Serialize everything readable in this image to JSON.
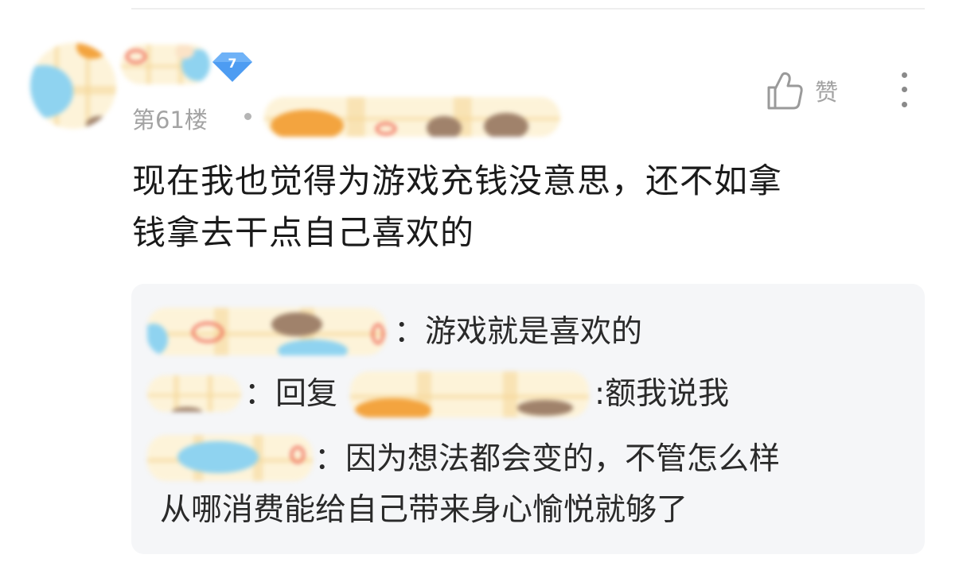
{
  "comment": {
    "level": "7",
    "floor": "第61楼",
    "like_label": "赞",
    "text_line1": "现在我也觉得为游戏充钱没意思，还不如拿",
    "text_line2": "钱拿去干点自己喜欢的"
  },
  "replies": [
    {
      "text": "：游戏就是喜欢的"
    },
    {
      "prefix": "：回复",
      "text": ":额我说我"
    },
    {
      "text": "：因为想法都会变的，不管怎么样",
      "continuation": "从哪消费能给自己带来身心愉悦就够了"
    }
  ],
  "icons": [
    "level-diamond-icon",
    "thumbs-up-icon",
    "more-vertical-icon"
  ],
  "colors": {
    "badge": "#4d9cf2",
    "meta_text": "#a3a3a3",
    "reply_background": "#f5f6f8"
  }
}
